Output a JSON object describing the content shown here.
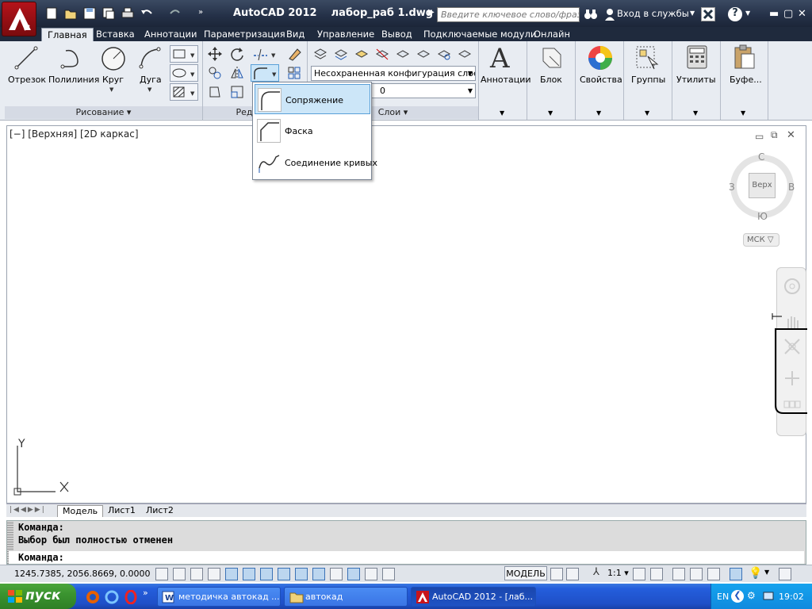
{
  "window": {
    "title": "AutoCAD 2012    лабор_раб 1.dwg",
    "search_placeholder": "Введите ключевое слово/фразу",
    "login_label": "Вход в службы"
  },
  "ribbon_tabs": [
    "Главная",
    "Вставка",
    "Аннотации",
    "Параметризация",
    "Вид",
    "Управление",
    "Вывод",
    "Подключаемые модули",
    "Онлайн"
  ],
  "draw_panel": {
    "tools": [
      "Отрезок",
      "Полилиния",
      "Круг",
      "Дуга"
    ],
    "footer": "Рисование"
  },
  "modify_panel": {
    "footer": "Редакти"
  },
  "layers_panel": {
    "layer_state": "Несохраненная конфигурация слоев",
    "current_layer": "0",
    "footer": "Слои"
  },
  "big_panels": [
    "Аннотации",
    "Блок",
    "Свойства",
    "Группы",
    "Утилиты",
    "Буфе..."
  ],
  "fillet_menu": {
    "items": [
      "Сопряжение",
      "Фаска",
      "Соединение кривых"
    ]
  },
  "viewport": {
    "label": "[−] [Верхняя] [2D каркас]",
    "viewcube": {
      "north": "С",
      "south": "Ю",
      "west": "З",
      "east": "В",
      "face": "Верх",
      "ucs": "МСК"
    },
    "ucs_x": "X",
    "ucs_y": "Y"
  },
  "layout_tabs": [
    "Модель",
    "Лист1",
    "Лист2"
  ],
  "command": {
    "lines": [
      "Команда:",
      "Выбор был полностью отменен",
      "Команда:"
    ]
  },
  "status": {
    "coords": "1245.7385, 2056.8669, 0.0000",
    "model": "МОДЕЛЬ",
    "scale": "1:1"
  },
  "taskbar": {
    "start": "пуск",
    "windows": [
      "методичка автокад ...",
      "автокад",
      "AutoCAD 2012 - [лаб..."
    ],
    "lang": "EN",
    "clock": "19:02"
  },
  "colors": {
    "accent": "#c8141c",
    "ribbon_bg": "#e8ecf2",
    "highlight": "#cce6f8",
    "taskbar": "#245edc"
  }
}
